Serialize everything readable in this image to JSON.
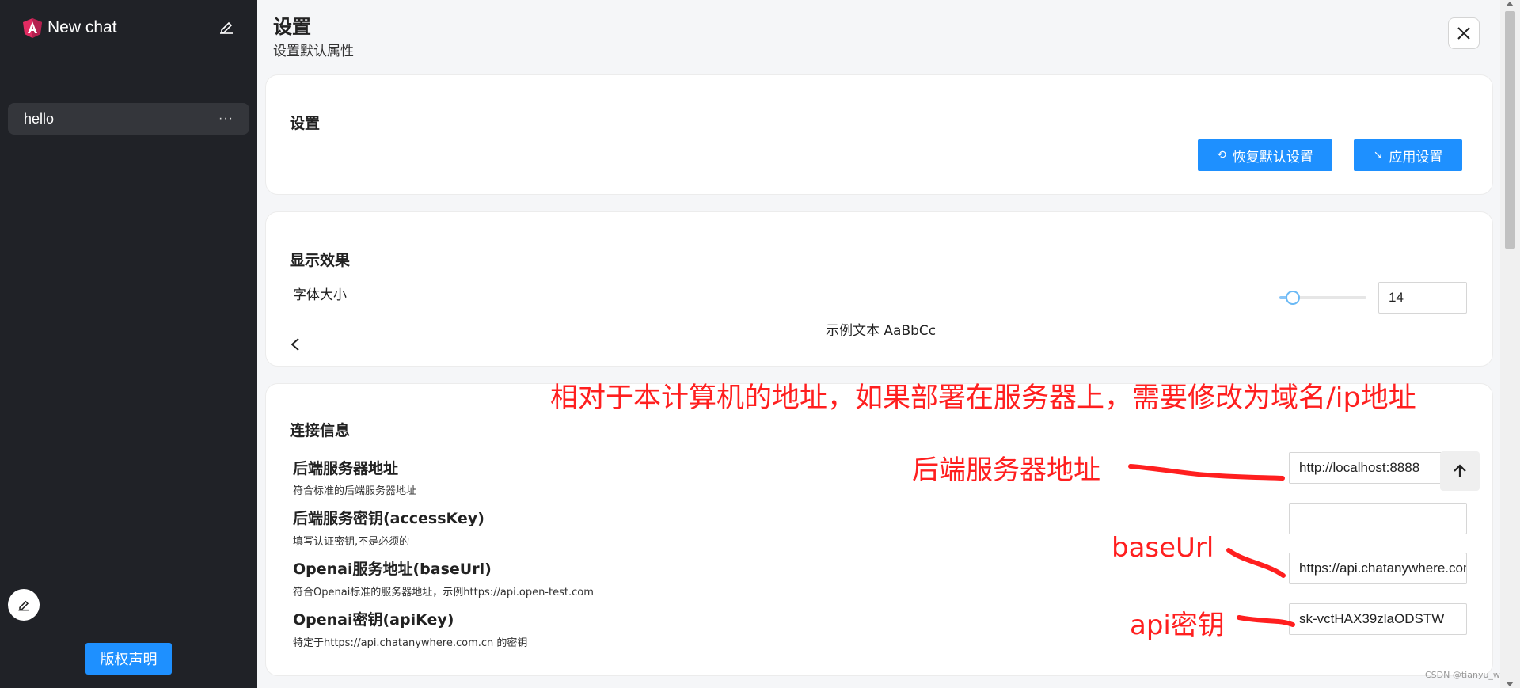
{
  "sidebar": {
    "title": "New chat",
    "chats": [
      {
        "label": "hello",
        "more": "···"
      }
    ],
    "copyright_label": "版权声明"
  },
  "header": {
    "title": "设置",
    "subtitle": "设置默认属性"
  },
  "settings_card": {
    "title": "设置",
    "reset_label": "恢复默认设置",
    "apply_label": "应用设置"
  },
  "display_card": {
    "title": "显示效果",
    "font_size_label": "字体大小",
    "font_size_value": "14",
    "font_size_fraction": 0.15,
    "sample_text": "示例文本 AaBbCc"
  },
  "connection_card": {
    "title": "连接信息",
    "fields": [
      {
        "label": "后端服务器地址",
        "hint": "符合标准的后端服务器地址",
        "value": "http://localhost:8888"
      },
      {
        "label": "后端服务密钥(accessKey)",
        "hint": "填写认证密钥,不是必须的",
        "value": ""
      },
      {
        "label": "Openai服务地址(baseUrl)",
        "hint": "符合Openai标准的服务器地址，示例https://api.open-test.com",
        "value": "https://api.chatanywhere.com.cn"
      },
      {
        "label": "Openai密钥(apiKey)",
        "hint": "特定于https://api.chatanywhere.com.cn 的密钥",
        "value": "sk-vctHAX39zlaODSTW"
      }
    ]
  },
  "annotations": {
    "top_note": "相对于本计算机的地址，如果部署在服务器上，需要修改为域名/ip地址",
    "backend": "后端服务器地址",
    "base_url": "baseUrl",
    "api_key": "api密钥"
  },
  "watermark": "CSDN @tianyu_w",
  "colors": {
    "accent": "#1e90ff",
    "sidebar_bg": "#202227",
    "annotation": "#ff1f1f"
  }
}
